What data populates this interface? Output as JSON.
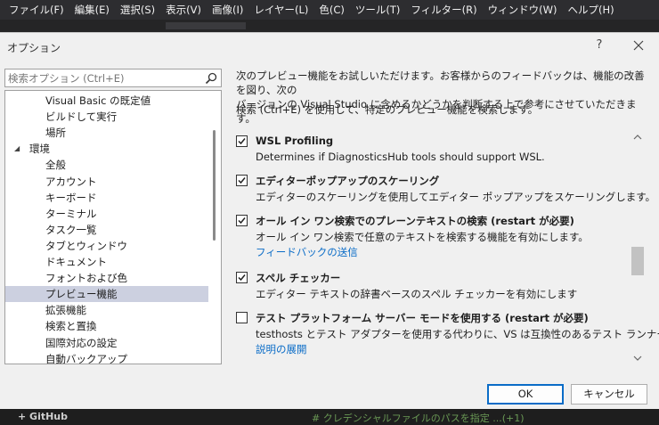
{
  "menubar": [
    "ファイル(F)",
    "編集(E)",
    "選択(S)",
    "表示(V)",
    "画像(I)",
    "レイヤー(L)",
    "色(C)",
    "ツール(T)",
    "フィルター(R)",
    "ウィンドウ(W)",
    "ヘルプ(H)"
  ],
  "dialog": {
    "title": "オプション",
    "help": "?",
    "search_placeholder": "検索オプション (Ctrl+E)"
  },
  "tree": [
    {
      "label": "Visual Basic の既定値"
    },
    {
      "label": "ビルドして実行"
    },
    {
      "label": "場所"
    },
    {
      "label": "環境"
    },
    {
      "label": "全般"
    },
    {
      "label": "アカウント"
    },
    {
      "label": "キーボード"
    },
    {
      "label": "ターミナル"
    },
    {
      "label": "タスク一覧"
    },
    {
      "label": "タブとウィンドウ"
    },
    {
      "label": "ドキュメント"
    },
    {
      "label": "フォントおよび色"
    },
    {
      "label": "プレビュー機能"
    },
    {
      "label": "拡張機能"
    },
    {
      "label": "検索と置換"
    },
    {
      "label": "国際対応の設定"
    },
    {
      "label": "自動バックアップ"
    }
  ],
  "intro": {
    "line1": "次のプレビュー機能をお試しいただけます。お客様からのフィードバックは、機能の改善を図り、次の",
    "line2": "バージョンの Visual Studio に含めるかどうかを判断する上で参考にさせていただきます。",
    "hint": "検索 (Ctrl+E) を使用して、特定のプレビュー機能を検索します。"
  },
  "features": [
    {
      "title": "WSL Profiling",
      "desc": "Determines if DiagnosticsHub tools should support WSL.",
      "checked": true,
      "link": ""
    },
    {
      "title": "エディターポップアップのスケーリング",
      "desc": "エディターのスケーリングを使用してエディター ポップアップをスケーリングします。",
      "checked": true,
      "link": ""
    },
    {
      "title": "オール イン ワン検索でのプレーンテキストの検索 (restart が必要)",
      "desc": "オール イン ワン検索で任意のテキストを検索する機能を有効にします。",
      "checked": true,
      "link": "フィードバックの送信"
    },
    {
      "title": "スペル チェッカー",
      "desc": "エディター テキストの辞書ベースのスペル チェッカーを有効にします",
      "checked": true,
      "link": ""
    },
    {
      "title": "テスト プラットフォーム サーバー モードを使用する (restart が必要)",
      "desc": "testhosts とテスト アダプターを使用する代わりに、VS は互換性のあるテスト ランナーを...",
      "checked": false,
      "link": "説明の展開"
    }
  ],
  "buttons": {
    "ok": "OK",
    "cancel": "キャンセル"
  },
  "bottom": {
    "code": "+ GitHub",
    "comment": "# クレデンシャルファイルのパスを指定 ...(+1)"
  }
}
